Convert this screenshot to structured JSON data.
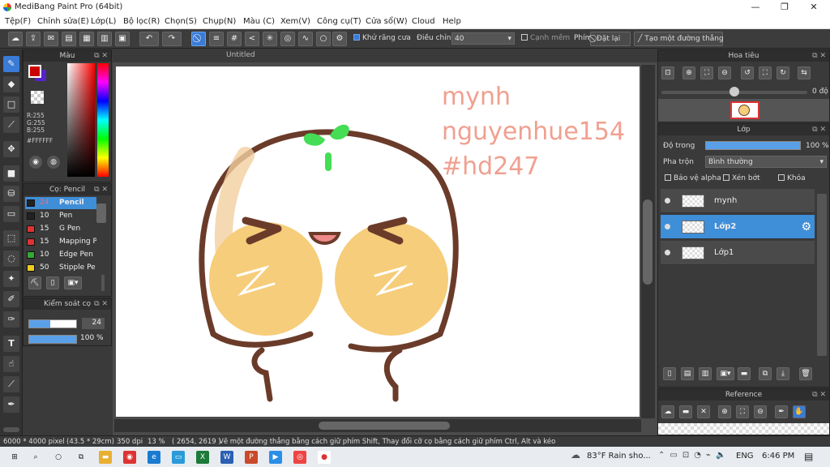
{
  "window": {
    "title": "MediBang Paint Pro (64bit)"
  },
  "menu": [
    "Tệp(F)",
    "Chỉnh sửa(E)",
    "Lớp(L)",
    "Bộ lọc(R)",
    "Chọn(S)",
    "Chụp(N)",
    "Màu (C)",
    "Xem(V)",
    "Công cụ(T)",
    "Cửa sổ(W)",
    "Cloud",
    "Help"
  ],
  "toolbar": {
    "antialias_label": "Khử răng cưa",
    "correction_label": "Điều chỉnh",
    "correction_value": "40",
    "soft_edge_label": "Cạnh mềm",
    "key_label": "Phím",
    "reset_label": "Đặt lại",
    "straight_line_label": "Tạo một đường thẳng"
  },
  "color_panel": {
    "title": "Màu",
    "r": "R:255",
    "g": "G:255",
    "b": "B:255",
    "hex": "#FFFFFF",
    "fg_color": "#cc0000",
    "bg_color": "#ffffff"
  },
  "brush_panel": {
    "title": "Cọ: Pencil",
    "brushes": [
      {
        "size": "24",
        "name": "Pencil",
        "color": "#222222"
      },
      {
        "size": "10",
        "name": "Pen",
        "color": "#222222"
      },
      {
        "size": "15",
        "name": "G Pen",
        "color": "#dd3333"
      },
      {
        "size": "15",
        "name": "Mapping P",
        "color": "#dd3333"
      },
      {
        "size": "10",
        "name": "Edge Pen",
        "color": "#33aa33"
      },
      {
        "size": "50",
        "name": "Stipple Pe",
        "color": "#eecc22"
      }
    ]
  },
  "brush_control": {
    "title": "Kiểm soát cọ",
    "size": "24",
    "opacity": "100 %",
    "size_fraction": 0.45,
    "opacity_fraction": 1.0
  },
  "canvas": {
    "tab_title": "Untitled",
    "text_lines": [
      "mynh",
      "nguyenhue154",
      "#hd247"
    ],
    "text_color": "#f0a090"
  },
  "navigator": {
    "title": "Hoa tiêu",
    "angle": "0 độ"
  },
  "layer_panel": {
    "title": "Lớp",
    "opacity_label": "Độ trong",
    "opacity_value": "100 %",
    "blend_label": "Pha trộn",
    "blend_value": "Bình thường",
    "protect_alpha": "Bảo vệ alpha",
    "clipping": "Xén bớt",
    "lock": "Khóa",
    "layers": [
      {
        "name": "mynh",
        "selected": false
      },
      {
        "name": "Lớp2",
        "selected": true
      },
      {
        "name": "Lớp1",
        "selected": false
      }
    ]
  },
  "reference": {
    "title": "Reference"
  },
  "status": {
    "size": "6000 * 4000 pixel",
    "cm": "(43.5 * 29cm)",
    "dpi": "350 dpi",
    "zoom": "13 %",
    "coords": "( 2654, 2619 )",
    "hint": "Vẽ một đường thẳng bằng cách giữ phím Shift, Thay đổi cỡ cọ bằng cách giữ phím Ctrl, Alt và kéo"
  },
  "taskbar": {
    "weather": "83°F  Rain sho...",
    "lang": "ENG",
    "time": "6:46 PM"
  }
}
